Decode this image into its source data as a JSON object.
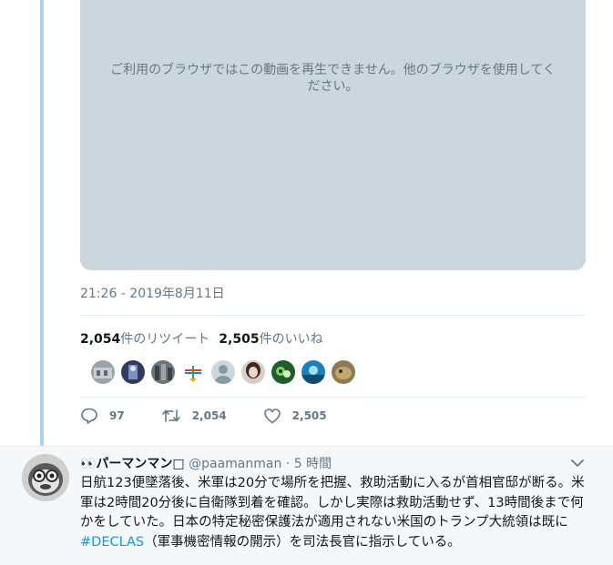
{
  "video": {
    "unsupported_message": "ご利用のブラウザではこの動画を再生できません。他のブラウザを使用してください。"
  },
  "tweet": {
    "timestamp": "21:26 - 2019年8月11日",
    "retweet_count": "2,054",
    "retweet_label": "件のリツイート",
    "like_count": "2,505",
    "like_label": "件のいいね",
    "likers": [
      "liker-1",
      "liker-2",
      "liker-3",
      "liker-4",
      "liker-5",
      "liker-6",
      "liker-7",
      "liker-8",
      "liker-9"
    ],
    "actions": {
      "reply_count": "97",
      "retweet_count": "2,054",
      "like_count": "2,505"
    }
  },
  "reply": {
    "display_name": "👀パーマンマン□",
    "handle": "@paamanman",
    "separator": " · ",
    "time": "5 時間",
    "text_before": "日航123便墜落後、米軍は20分で場所を把握、救助活動に入るが首相官邸が断る。米軍は2時間20分後に自衛隊到着を確認。しかし実際は救助活動せず、13時間後まで何かをしていた。日本の特定秘密保護法が適用されない米国のトランプ大統領は既に",
    "hashtag": "#DECLAS",
    "text_after": "（軍事機密情報の開示）を司法長官に指示している。"
  },
  "colors": {
    "accent": "#1b95e0",
    "thread_line": "#a7d4f2",
    "video_bg": "#ccd6dd",
    "muted": "#657786"
  }
}
